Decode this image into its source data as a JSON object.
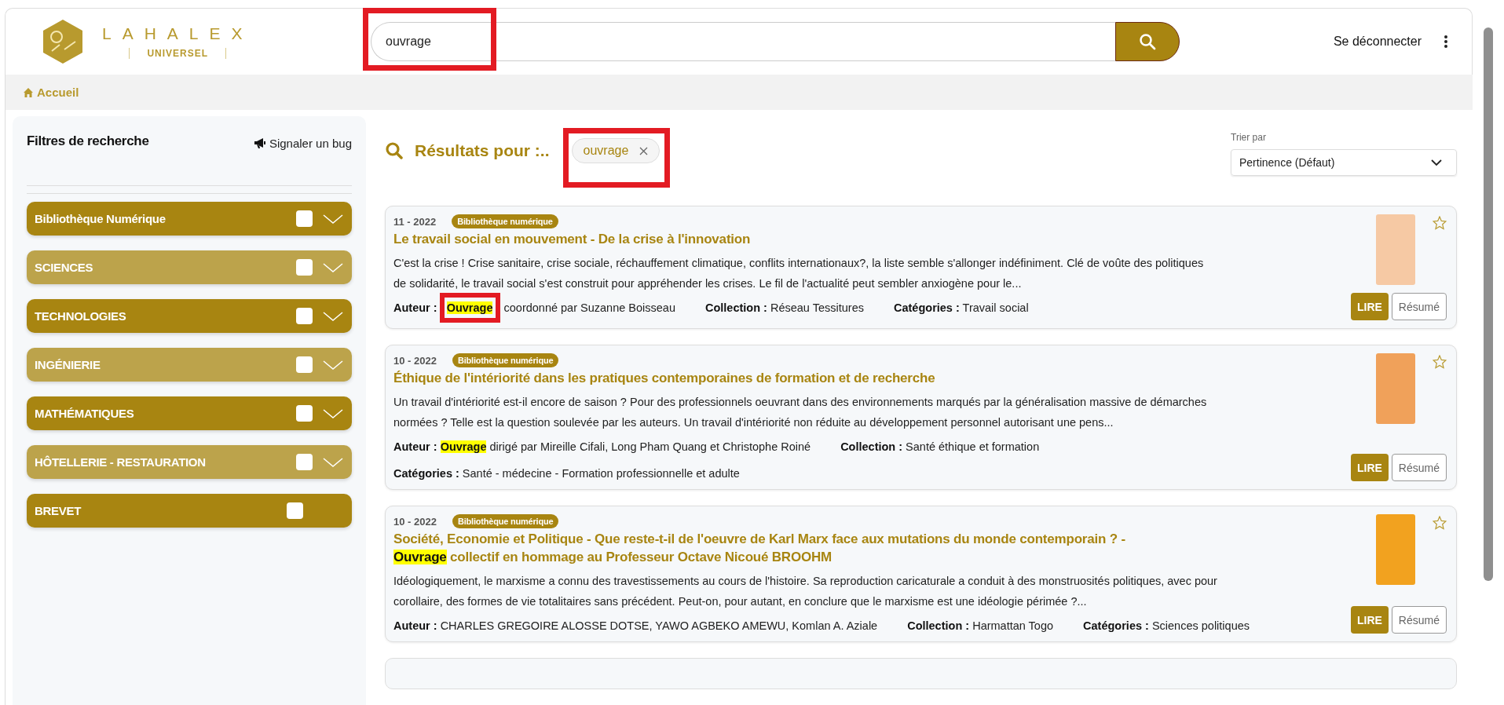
{
  "header": {
    "logo": {
      "name": "LAHALEX",
      "subtitle": "UNIVERSEL"
    },
    "search": {
      "value": "ouvrage",
      "framed": true
    },
    "logout": "Se déconnecter"
  },
  "breadcrumb": {
    "label": "Accueil"
  },
  "sidebar": {
    "title": "Filtres de recherche",
    "report_bug": "Signaler un bug",
    "filters": [
      {
        "label": "Bibliothèque Numérique",
        "checked": false,
        "expandable": true
      },
      {
        "label": "SCIENCES",
        "checked": false,
        "expandable": true
      },
      {
        "label": "TECHNOLOGIES",
        "checked": false,
        "expandable": true
      },
      {
        "label": "INGÉNIERIE",
        "checked": false,
        "expandable": true
      },
      {
        "label": "MATHÉMATIQUES",
        "checked": false,
        "expandable": true
      },
      {
        "label": "HÔTELLERIE - RESTAURATION",
        "checked": false,
        "expandable": true
      },
      {
        "label": "BREVET",
        "checked": false,
        "expandable": false
      }
    ]
  },
  "results": {
    "heading": "Résultats pour :..",
    "chip": {
      "label": "ouvrage",
      "framed": true
    },
    "sort": {
      "label": "Trier par",
      "value": "Pertinence (Défaut)"
    },
    "items": [
      {
        "date": "11 - 2022",
        "badge": "Bibliothèque numérique",
        "title": [
          {
            "text": "Le travail social en mouvement - De la crise à l'innovation",
            "highlighted": false
          }
        ],
        "description": "C'est la crise ! Crise sanitaire, crise sociale, réchauffement climatique, conflits internationaux?, la liste semble s'allonger indéfiniment. Clé de voûte des politiques de solidarité, le travail social s'est construit pour appréhender les crises. Le fil de l'actualité peut sembler anxiogène pour le...",
        "meta_lines": [
          [
            {
              "label": "Auteur :",
              "value": [
                {
                  "text": "Ouvrage",
                  "highlighted": true,
                  "framed": true
                },
                {
                  "text": " coordonné par Suzanne Boisseau",
                  "highlighted": false,
                  "framed": false
                }
              ]
            },
            {
              "label": "Collection :",
              "value": [
                {
                  "text": "Réseau Tessitures",
                  "highlighted": false,
                  "framed": false
                }
              ]
            },
            {
              "label": "Catégories :",
              "value": [
                {
                  "text": "Travail social",
                  "highlighted": false,
                  "framed": false
                }
              ]
            }
          ]
        ],
        "favorite": false,
        "read": "LIRE",
        "summary": "Résumé"
      },
      {
        "date": "10 - 2022",
        "badge": "Bibliothèque numérique",
        "title": [
          {
            "text": "Éthique de l'intériorité dans les pratiques contemporaines de formation et de recherche",
            "highlighted": false
          }
        ],
        "description": "Un travail d'intériorité est-il encore de saison ? Pour des professionnels oeuvrant dans des environnements marqués par la généralisation massive de démarches normées ? Telle est la question soulevée par les auteurs. Un travail d'intériorité non réduite au développement personnel autorisant une pens...",
        "meta_lines": [
          [
            {
              "label": "Auteur :",
              "value": [
                {
                  "text": "Ouvrage",
                  "highlighted": true,
                  "framed": false
                },
                {
                  "text": " dirigé par Mireille Cifali, Long Pham Quang et Christophe Roiné",
                  "highlighted": false,
                  "framed": false
                }
              ]
            },
            {
              "label": "Collection :",
              "value": [
                {
                  "text": "Santé éthique et formation",
                  "highlighted": false,
                  "framed": false
                }
              ]
            }
          ],
          [
            {
              "label": "Catégories :",
              "value": [
                {
                  "text": "Santé - médecine - Formation professionnelle et adulte",
                  "highlighted": false,
                  "framed": false
                }
              ]
            }
          ]
        ],
        "favorite": false,
        "read": "LIRE",
        "summary": "Résumé"
      },
      {
        "date": "10 - 2022",
        "badge": "Bibliothèque numérique",
        "title": [
          {
            "text": "Société, Economie et Politique - Que reste-t-il de l'oeuvre de Karl Marx face aux mutations du monde contemporain ? - ",
            "highlighted": false
          },
          {
            "text": "Ouvrage",
            "highlighted": true
          },
          {
            "text": " collectif en hommage au Professeur Octave Nicoué BROOHM",
            "highlighted": false
          }
        ],
        "description": "Idéologiquement, le marxisme a connu des travestissements au cours de l'histoire. Sa reproduction caricaturale a conduit à des monstruosités politiques, avec pour corollaire, des formes de vie totalitaires sans précédent. Peut-on, pour autant, en conclure que le marxisme est une idéologie périmée ?...",
        "meta_lines": [
          [
            {
              "label": "Auteur :",
              "value": [
                {
                  "text": "CHARLES GREGOIRE ALOSSE DOTSE, YAWO AGBEKO AMEWU, Komlan A. Aziale",
                  "highlighted": false,
                  "framed": false
                }
              ]
            },
            {
              "label": "Collection :",
              "value": [
                {
                  "text": "Harmattan Togo",
                  "highlighted": false,
                  "framed": false
                }
              ]
            },
            {
              "label": "Catégories :",
              "value": [
                {
                  "text": "Sciences politiques",
                  "highlighted": false,
                  "framed": false
                }
              ]
            }
          ]
        ],
        "favorite": false,
        "read": "LIRE",
        "summary": "Résumé"
      }
    ]
  }
}
